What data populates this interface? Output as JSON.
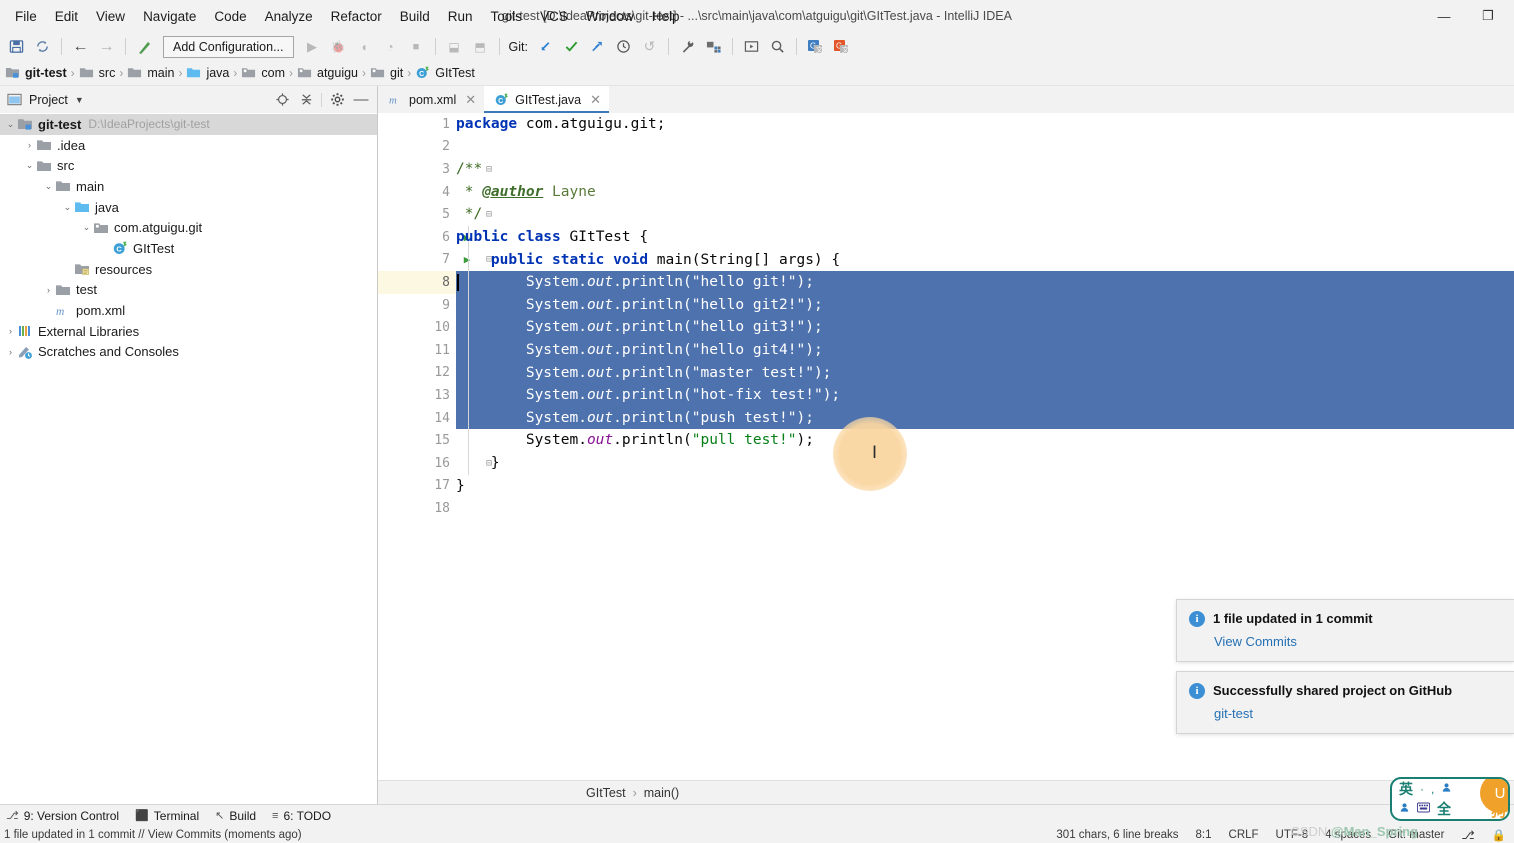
{
  "window": {
    "title": "git-test [D:\\IdeaProjects\\git-test] - ...\\src\\main\\java\\com\\atguigu\\git\\GItTest.java - IntelliJ IDEA",
    "minimize": "—",
    "maximize": "❐",
    "close": "✕"
  },
  "menu": [
    {
      "label": "File"
    },
    {
      "label": "Edit"
    },
    {
      "label": "View"
    },
    {
      "label": "Navigate"
    },
    {
      "label": "Code"
    },
    {
      "label": "Analyze"
    },
    {
      "label": "Refactor"
    },
    {
      "label": "Build"
    },
    {
      "label": "Run"
    },
    {
      "label": "Tools"
    },
    {
      "label": "VCS"
    },
    {
      "label": "Window"
    },
    {
      "label": "Help"
    }
  ],
  "toolbar": {
    "save_icon": "💾",
    "sync_icon": "↻",
    "back_icon": "←",
    "forward_icon": "→",
    "build_icon": "↖",
    "add_configuration": "Add Configuration...",
    "run_icon": "▶",
    "debug_icon": "🐞",
    "run_coverage_icon": "◑",
    "profile_icon": "◔",
    "stop_icon": "■",
    "update_icon": "⬒",
    "commit_icon": "⬓",
    "git_label": "Git:",
    "git_update_icon": "↙",
    "git_commit_icon": "✓",
    "git_push_icon": "↠",
    "git_history_icon": "🕓",
    "git_rollback_icon": "↺",
    "settings_icon": "🔧",
    "project_structure_icon": "◰",
    "layout_icon": "▣",
    "search_icon": "🔍",
    "google_blue_icon": "G",
    "google_orange_icon": "G"
  },
  "breadcrumb": [
    {
      "label": "git-test",
      "icon": "project-folder",
      "root": true
    },
    {
      "label": "src",
      "icon": "folder"
    },
    {
      "label": "main",
      "icon": "folder"
    },
    {
      "label": "java",
      "icon": "source-folder"
    },
    {
      "label": "com",
      "icon": "package"
    },
    {
      "label": "atguigu",
      "icon": "package"
    },
    {
      "label": "git",
      "icon": "package"
    },
    {
      "label": "GItTest",
      "icon": "class"
    }
  ],
  "project_panel": {
    "title": "Project",
    "caret": "▼",
    "actions": [
      {
        "name": "locate-icon",
        "glyph": "⨁"
      },
      {
        "name": "collapse-all-icon",
        "glyph": "⨍"
      },
      {
        "name": "settings-icon",
        "glyph": "⚙"
      },
      {
        "name": "hide-icon",
        "glyph": "—"
      }
    ],
    "tree": [
      {
        "label": "git-test",
        "path": "D:\\IdeaProjects\\git-test",
        "indent": 0,
        "arrow": "⌄",
        "icon": "project-folder",
        "selected": true,
        "bold": true
      },
      {
        "label": ".idea",
        "indent": 1,
        "arrow": "›",
        "icon": "folder"
      },
      {
        "label": "src",
        "indent": 1,
        "arrow": "⌄",
        "icon": "folder"
      },
      {
        "label": "main",
        "indent": 2,
        "arrow": "⌄",
        "icon": "folder"
      },
      {
        "label": "java",
        "indent": 3,
        "arrow": "⌄",
        "icon": "source-folder"
      },
      {
        "label": "com.atguigu.git",
        "indent": 4,
        "arrow": "⌄",
        "icon": "package"
      },
      {
        "label": "GItTest",
        "indent": 5,
        "arrow": "",
        "icon": "class"
      },
      {
        "label": "resources",
        "indent": 3,
        "arrow": "",
        "icon": "resource-folder"
      },
      {
        "label": "test",
        "indent": 2,
        "arrow": "›",
        "icon": "folder"
      },
      {
        "label": "pom.xml",
        "indent": 2,
        "arrow": "",
        "icon": "maven"
      },
      {
        "label": "External Libraries",
        "indent": 0,
        "arrow": "›",
        "icon": "libraries"
      },
      {
        "label": "Scratches and Consoles",
        "indent": 0,
        "arrow": "›",
        "icon": "scratches"
      }
    ]
  },
  "editor": {
    "tabs": [
      {
        "label": "pom.xml",
        "icon": "maven",
        "active": false,
        "close": "✕"
      },
      {
        "label": "GItTest.java",
        "icon": "class",
        "active": true,
        "close": "✕"
      }
    ],
    "selection_color": "#4e72ae",
    "caret_line_color": "#fcf8e2",
    "line_count": 18,
    "selected_lines": [
      8,
      14
    ],
    "caret_line": 8,
    "lines": [
      {
        "n": 1,
        "tokens": [
          {
            "t": "package",
            "c": "kw"
          },
          {
            "t": " com.atguigu.git;",
            "c": "plain"
          }
        ]
      },
      {
        "n": 2,
        "tokens": []
      },
      {
        "n": 3,
        "tokens": [
          {
            "t": "/**",
            "c": "docline"
          }
        ],
        "fold": "⊖"
      },
      {
        "n": 4,
        "tokens": [
          {
            "t": " * ",
            "c": "docline"
          },
          {
            "t": "@author",
            "c": "tagname"
          },
          {
            "t": " Layne",
            "c": "doc"
          }
        ]
      },
      {
        "n": 5,
        "tokens": [
          {
            "t": " */",
            "c": "docline"
          }
        ],
        "fold": "⊖"
      },
      {
        "n": 6,
        "tokens": [
          {
            "t": "public class ",
            "c": "kw"
          },
          {
            "t": "GItTest {",
            "c": "plain"
          }
        ],
        "run": true
      },
      {
        "n": 7,
        "tokens": [
          {
            "t": "    public static void ",
            "c": "kw"
          },
          {
            "t": "main(String[] args) {",
            "c": "plain"
          }
        ],
        "run": true,
        "fold": "⊖"
      },
      {
        "n": 8,
        "tokens": [
          {
            "t": "        System.",
            "c": "plain"
          },
          {
            "t": "out",
            "c": "italv"
          },
          {
            "t": ".println(",
            "c": "plain"
          },
          {
            "t": "\"hello git!\"",
            "c": "str"
          },
          {
            "t": ");",
            "c": "plain"
          }
        ]
      },
      {
        "n": 9,
        "tokens": [
          {
            "t": "        System.",
            "c": "plain"
          },
          {
            "t": "out",
            "c": "italv"
          },
          {
            "t": ".println(",
            "c": "plain"
          },
          {
            "t": "\"hello git2!\"",
            "c": "str"
          },
          {
            "t": ");",
            "c": "plain"
          }
        ]
      },
      {
        "n": 10,
        "tokens": [
          {
            "t": "        System.",
            "c": "plain"
          },
          {
            "t": "out",
            "c": "italv"
          },
          {
            "t": ".println(",
            "c": "plain"
          },
          {
            "t": "\"hello git3!\"",
            "c": "str"
          },
          {
            "t": ");",
            "c": "plain"
          }
        ]
      },
      {
        "n": 11,
        "tokens": [
          {
            "t": "        System.",
            "c": "plain"
          },
          {
            "t": "out",
            "c": "italv"
          },
          {
            "t": ".println(",
            "c": "plain"
          },
          {
            "t": "\"hello git4!\"",
            "c": "str"
          },
          {
            "t": ");",
            "c": "plain"
          }
        ]
      },
      {
        "n": 12,
        "tokens": [
          {
            "t": "        System.",
            "c": "plain"
          },
          {
            "t": "out",
            "c": "italv"
          },
          {
            "t": ".println(",
            "c": "plain"
          },
          {
            "t": "\"master test!\"",
            "c": "str"
          },
          {
            "t": ");",
            "c": "plain"
          }
        ]
      },
      {
        "n": 13,
        "tokens": [
          {
            "t": "        System.",
            "c": "plain"
          },
          {
            "t": "out",
            "c": "italv"
          },
          {
            "t": ".println(",
            "c": "plain"
          },
          {
            "t": "\"hot-fix test!\"",
            "c": "str"
          },
          {
            "t": ");",
            "c": "plain"
          }
        ]
      },
      {
        "n": 14,
        "tokens": [
          {
            "t": "        System.",
            "c": "plain"
          },
          {
            "t": "out",
            "c": "italv"
          },
          {
            "t": ".println(",
            "c": "plain"
          },
          {
            "t": "\"push test!\"",
            "c": "str"
          },
          {
            "t": ");",
            "c": "plain"
          }
        ]
      },
      {
        "n": 15,
        "tokens": [
          {
            "t": "        System.",
            "c": "plain"
          },
          {
            "t": "out",
            "c": "italv"
          },
          {
            "t": ".println(",
            "c": "plain"
          },
          {
            "t": "\"pull test!\"",
            "c": "str"
          },
          {
            "t": ");",
            "c": "plain"
          }
        ]
      },
      {
        "n": 16,
        "tokens": [
          {
            "t": "    }",
            "c": "plain"
          }
        ],
        "fold": "⊖"
      },
      {
        "n": 17,
        "tokens": [
          {
            "t": "}",
            "c": "plain"
          }
        ]
      },
      {
        "n": 18,
        "tokens": []
      }
    ],
    "bottom_breadcrumb": [
      {
        "label": "GItTest"
      },
      {
        "label": "main()"
      }
    ],
    "breadcrumb_sep": "›"
  },
  "notifications": [
    {
      "title": "1 file updated in 1 commit",
      "link": "View Commits",
      "icon": "info-icon"
    },
    {
      "title": "Successfully shared project on GitHub",
      "link": "git-test",
      "icon": "info-icon"
    }
  ],
  "tool_window_bar": [
    {
      "label": "9: Version Control",
      "icon": "⎇"
    },
    {
      "label": "Terminal",
      "icon": "⬛"
    },
    {
      "label": "Build",
      "icon": "↖"
    },
    {
      "label": "6: TODO",
      "icon": "≡"
    }
  ],
  "status_bar": {
    "left": "1 file updated in 1 commit // View Commits (moments ago)",
    "right": [
      {
        "label": "301 chars, 6 line breaks"
      },
      {
        "label": "8:1"
      },
      {
        "label": "CRLF"
      },
      {
        "label": "UTF-8"
      },
      {
        "label": "4 spaces"
      },
      {
        "label": "Git: master"
      },
      {
        "label": "⎇"
      },
      {
        "label": "🔒"
      }
    ]
  },
  "ime": {
    "mode": "英",
    "dot": "·",
    "comma": ",",
    "person": "👤",
    "keyboard": "⌨",
    "full": "全",
    "sogou": "狗",
    "badge": "U"
  },
  "watermark": {
    "prefix": "CSDN ",
    "user": "@Man_Spring"
  },
  "colors": {
    "selection": "#4e72ae",
    "accent": "#3d7ab8",
    "link": "#2470b3",
    "string": "#067d17",
    "keyword": "#0033b3",
    "caret_line": "#fcf8e2"
  }
}
